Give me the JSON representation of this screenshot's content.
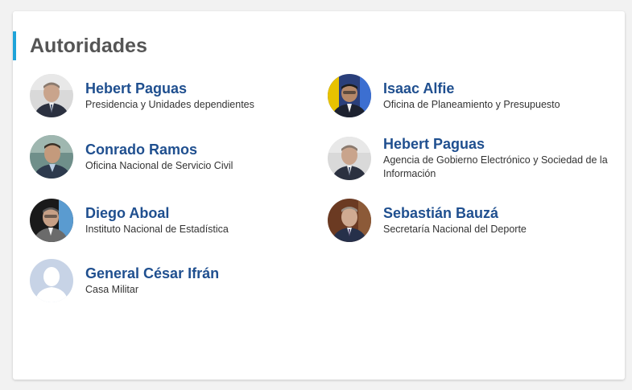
{
  "section": {
    "title": "Autoridades"
  },
  "colors": {
    "accent": "#1ea3d9",
    "name_link": "#1f4f8f",
    "title_text": "#555555",
    "role_text": "#333333"
  },
  "authorities": [
    {
      "name": "Hebert Paguas",
      "role": "Presidencia y Unidades dependientes",
      "photo": "portrait-photo"
    },
    {
      "name": "Isaac Alfie",
      "role": "Oficina de Planeamiento y Presupuesto",
      "photo": "portrait-photo"
    },
    {
      "name": "Conrado Ramos",
      "role": "Oficina Nacional de Servicio Civil",
      "photo": "portrait-photo"
    },
    {
      "name": "Hebert Paguas",
      "role": "Agencia de Gobierno Electrónico y Sociedad de la Información",
      "photo": "portrait-photo"
    },
    {
      "name": "Diego Aboal",
      "role": "Instituto Nacional de Estadística",
      "photo": "portrait-photo"
    },
    {
      "name": "Sebastián Bauzá",
      "role": "Secretaría Nacional del Deporte",
      "photo": "portrait-photo"
    },
    {
      "name": "General César Ifrán",
      "role": "Casa Militar",
      "photo": "placeholder-avatar-icon"
    }
  ]
}
